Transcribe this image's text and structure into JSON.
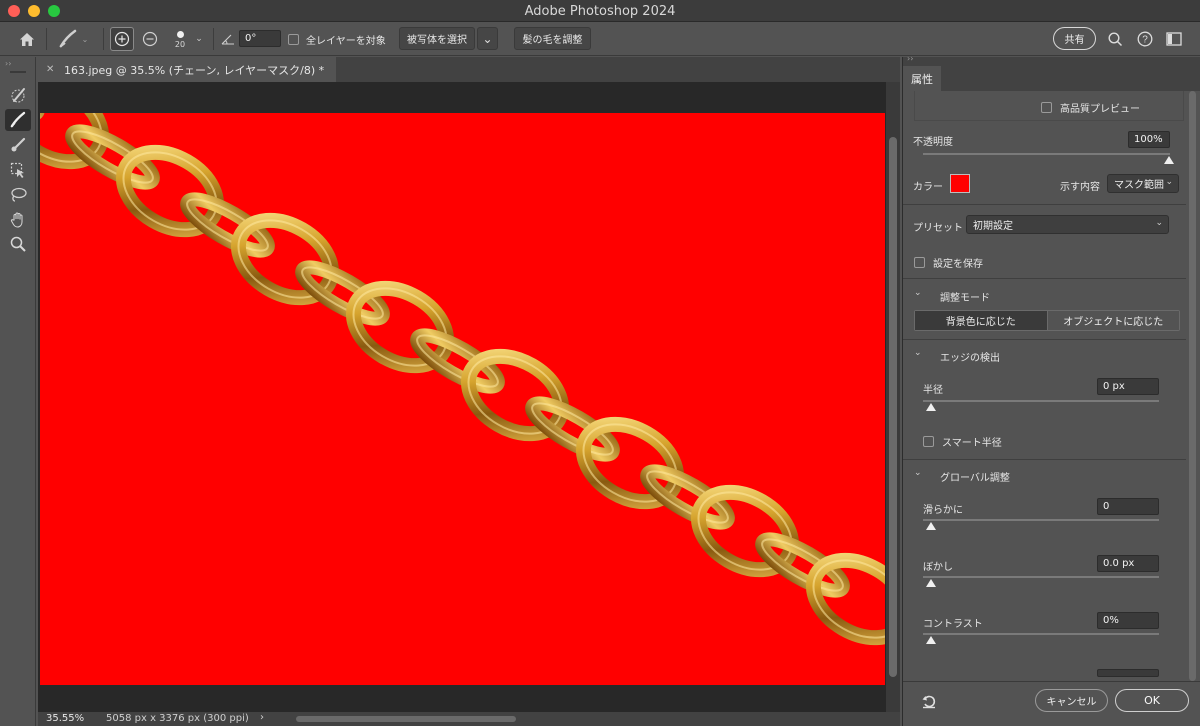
{
  "window": {
    "title": "Adobe Photoshop 2024"
  },
  "options_bar": {
    "brush_size": "20",
    "angle_value": "0°",
    "sample_all_layers_label": "全レイヤーを対象",
    "select_subject_label": "被写体を選択",
    "refine_hair_label": "髪の毛を調整",
    "share_label": "共有"
  },
  "document": {
    "tab_label": "163.jpeg @ 35.5% (チェーン, レイヤーマスク/8) *",
    "canvas_color": "#ff0000"
  },
  "status": {
    "zoom": "35.55%",
    "doc_size": "5058 px x 3376 px (300 ppi)",
    "arrow": "›"
  },
  "panel": {
    "tab_label": "属性",
    "hq_preview_label": "高品質プレビュー",
    "opacity_label": "不透明度",
    "opacity_value": "100%",
    "opacity_level": 1.0,
    "color_label": "カラー",
    "color_swatch": "#ff0000",
    "show_label": "示す内容",
    "show_value": "マスク範囲",
    "preset_label": "プリセット",
    "preset_value": "初期設定",
    "save_settings_label": "設定を保存",
    "adjust_mode_label": "調整モード",
    "mode_bg_label": "背景色に応じた",
    "mode_obj_label": "オブジェクトに応じた",
    "edge_detection_label": "エッジの検出",
    "radius_label": "半径",
    "radius_value": "0 px",
    "smart_radius_label": "スマート半径",
    "global_refine_label": "グローバル調整",
    "smooth_label": "滑らかに",
    "smooth_value": "0",
    "feather_label": "ぼかし",
    "feather_value": "0.0 px",
    "contrast_label": "コントラスト",
    "contrast_value": "0%",
    "cancel_label": "キャンセル",
    "ok_label": "OK"
  }
}
